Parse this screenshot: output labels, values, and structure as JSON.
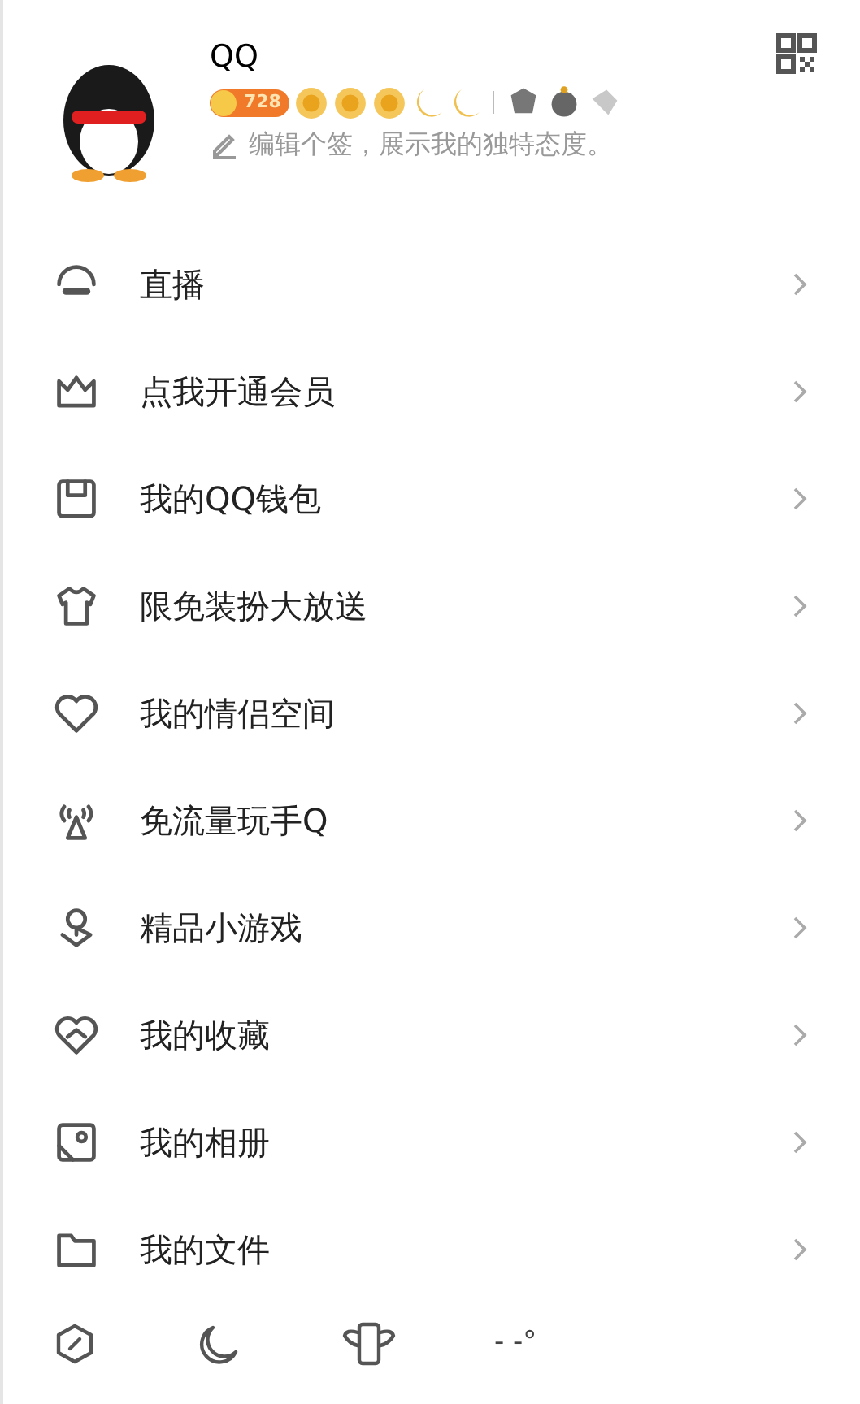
{
  "profile": {
    "name": "QQ",
    "level_badge": "728",
    "signature": "编辑个签，展示我的独特态度。"
  },
  "menu": [
    {
      "label": "直播"
    },
    {
      "label": "点我开通会员"
    },
    {
      "label": "我的QQ钱包"
    },
    {
      "label": "限免装扮大放送"
    },
    {
      "label": "我的情侣空间"
    },
    {
      "label": "免流量玩手Q"
    },
    {
      "label": "精品小游戏"
    },
    {
      "label": "我的收藏"
    },
    {
      "label": "我的相册"
    },
    {
      "label": "我的文件"
    }
  ],
  "bottom_bar": {
    "weather": "- -°"
  }
}
